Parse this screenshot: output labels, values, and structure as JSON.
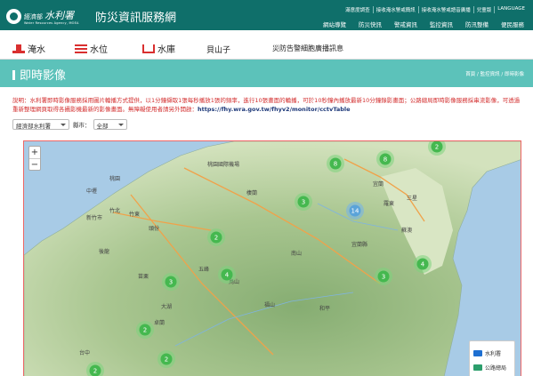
{
  "header": {
    "ministry": "經濟部",
    "agency": "水利署",
    "agency_en": "Water Resources Agency, MOEA",
    "title": "防災資訊服務網",
    "top_links": [
      "滿意度調查",
      "接收淹水警戒簡訊",
      "接收淹水警戒語音廣播",
      "兒童版",
      "LANGUAGE"
    ],
    "nav": [
      "網站導覽",
      "防災快訊",
      "警戒資訊",
      "監控資訊",
      "防汛整備",
      "便民服務"
    ]
  },
  "subnav": {
    "buttons": [
      "淹水",
      "水位",
      "水庫"
    ],
    "location": "貝山子",
    "cbs": "災防告警細胞廣播訊息"
  },
  "page": {
    "title": "即時影像",
    "breadcrumb": "首頁 / 監控資訊 / 即時影像"
  },
  "notice": {
    "text": "說明：水利署即時影像服務採用圖片輪播方式提供，以1分鐘擷取1張每秒播放1張的頻率，進行10張畫面的輪播，可於10秒鐘內播放最新10分鐘錄影畫面；公路總局即時影像服務採串流影像，可透過重新整理網頁取得各攝影機最新的影像畫面。無障礙使用者請另外開啟：",
    "url": "https://fhy.wra.gov.tw/fhyv2/monitor/cctvTable"
  },
  "filters": {
    "source": "經濟部水利署",
    "county_label": "縣市：",
    "county": "全部"
  },
  "map": {
    "zoom_in": "+",
    "zoom_out": "−",
    "places": [
      "桃園",
      "中壢",
      "新竹市",
      "竹北",
      "竹東",
      "頭份",
      "苗栗",
      "後龍",
      "大湖",
      "卓蘭",
      "台中",
      "桃園國際機場",
      "五峰",
      "宜蘭",
      "羅東",
      "蘇澳",
      "宜蘭縣",
      "南山",
      "和平",
      "福山",
      "鳥山",
      "三星",
      "棲蘭"
    ],
    "clusters": [
      "8",
      "8",
      "2",
      "3",
      "2",
      "3",
      "4",
      "2",
      "2",
      "14",
      "3",
      "4",
      "2"
    ],
    "legend": [
      {
        "label": "水利署",
        "color": "#1e6fd1"
      },
      {
        "label": "公路總局",
        "color": "#2c9e6c"
      }
    ]
  }
}
